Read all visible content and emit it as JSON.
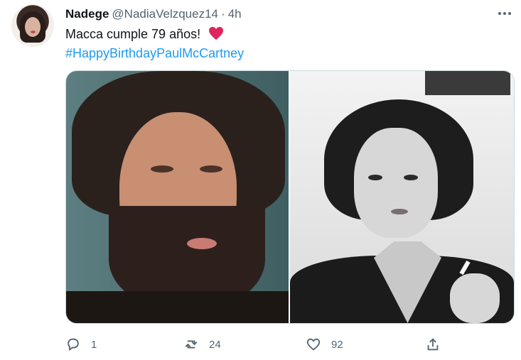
{
  "tweet": {
    "author": {
      "name": "Nadege",
      "handle": "@NadiaVelzquez14",
      "separator": "·",
      "time": "4h"
    },
    "text_line1": "Macca cumple 79 años!",
    "hashtag": "#HappyBirthdayPaulMcCartney",
    "emoji": "red-heart-emoji",
    "actions": {
      "reply_count": "1",
      "retweet_count": "24",
      "like_count": "92"
    }
  },
  "icons": {
    "more": "more-icon",
    "reply": "reply-icon",
    "retweet": "retweet-icon",
    "like": "heart-icon",
    "share": "share-icon"
  },
  "colors": {
    "text": "#0f1419",
    "muted": "#536471",
    "link": "#1d9bf0",
    "heart": "#e0245e",
    "border": "#cfd9de"
  }
}
